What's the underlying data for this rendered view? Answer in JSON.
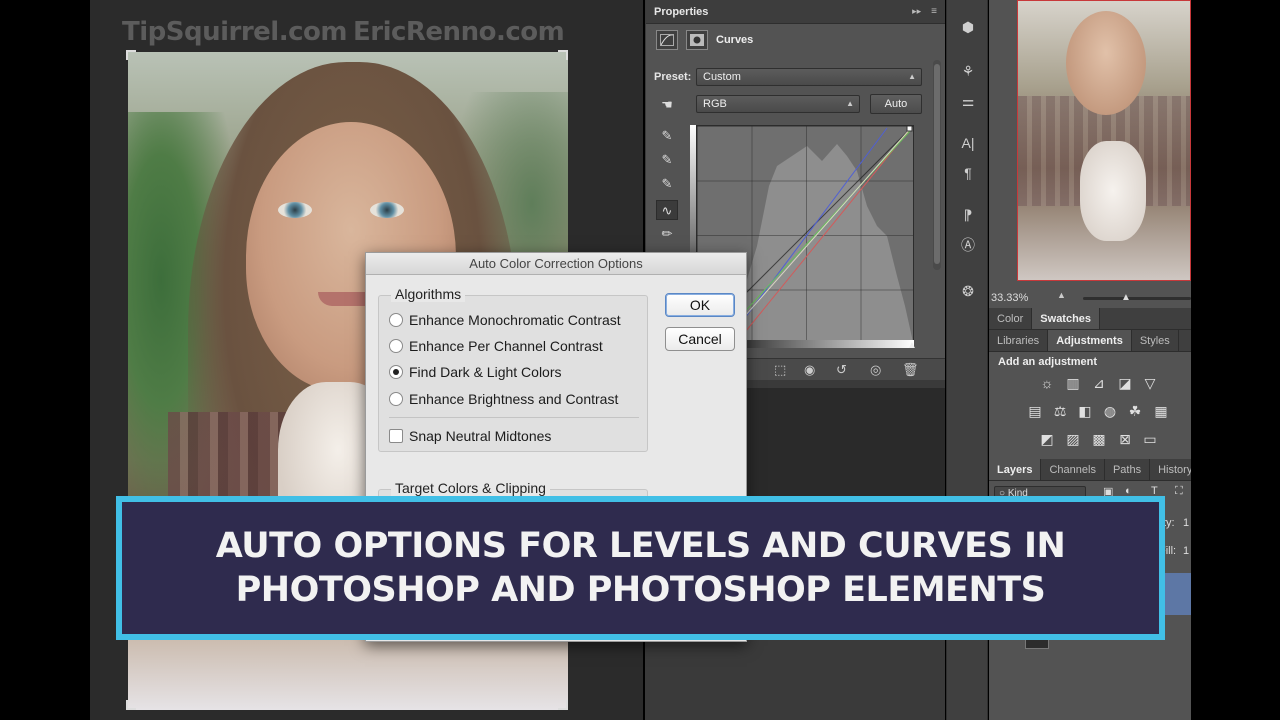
{
  "watermarks": [
    "TipSquirrel.com",
    "EricRenno.com"
  ],
  "dialog": {
    "title": "Auto Color Correction Options",
    "algorithms_label": "Algorithms",
    "options": [
      {
        "label": "Enhance Monochromatic Contrast",
        "selected": false
      },
      {
        "label": "Enhance Per Channel Contrast",
        "selected": false
      },
      {
        "label": "Find Dark & Light Colors",
        "selected": true
      },
      {
        "label": "Enhance Brightness and Contrast",
        "selected": false
      }
    ],
    "snap_label": "Snap Neutral Midtones",
    "snap_checked": false,
    "target_label": "Target Colors & Clipping",
    "ok_label": "OK",
    "cancel_label": "Cancel"
  },
  "properties": {
    "tab_label": "Properties",
    "panel_title": "Curves",
    "preset_label": "Preset:",
    "preset_value": "Custom",
    "channel_value": "RGB",
    "auto_label": "Auto"
  },
  "navigator": {
    "zoom": "33.33%"
  },
  "color_tabs": [
    "Color",
    "Swatches"
  ],
  "adjust_tabs": [
    "Libraries",
    "Adjustments",
    "Styles"
  ],
  "adjust_heading": "Add an adjustment",
  "layers_tabs": [
    "Layers",
    "Channels",
    "Paths",
    "History"
  ],
  "layers": {
    "kind_label": "Kind",
    "opacity_label": "ty:",
    "fill_label": "Fill:",
    "opacity_value": "1",
    "fill_value": "1"
  },
  "banner": {
    "line1": "AUTO OPTIONS FOR LEVELS AND CURVES IN",
    "line2": "PHOTOSHOP AND PHOTOSHOP ELEMENTS"
  },
  "colors": {
    "banner_bg": "#2f2b4e",
    "banner_border": "#41bfe6",
    "panel_bg": "#535353",
    "nav_frame": "#c8383a"
  }
}
